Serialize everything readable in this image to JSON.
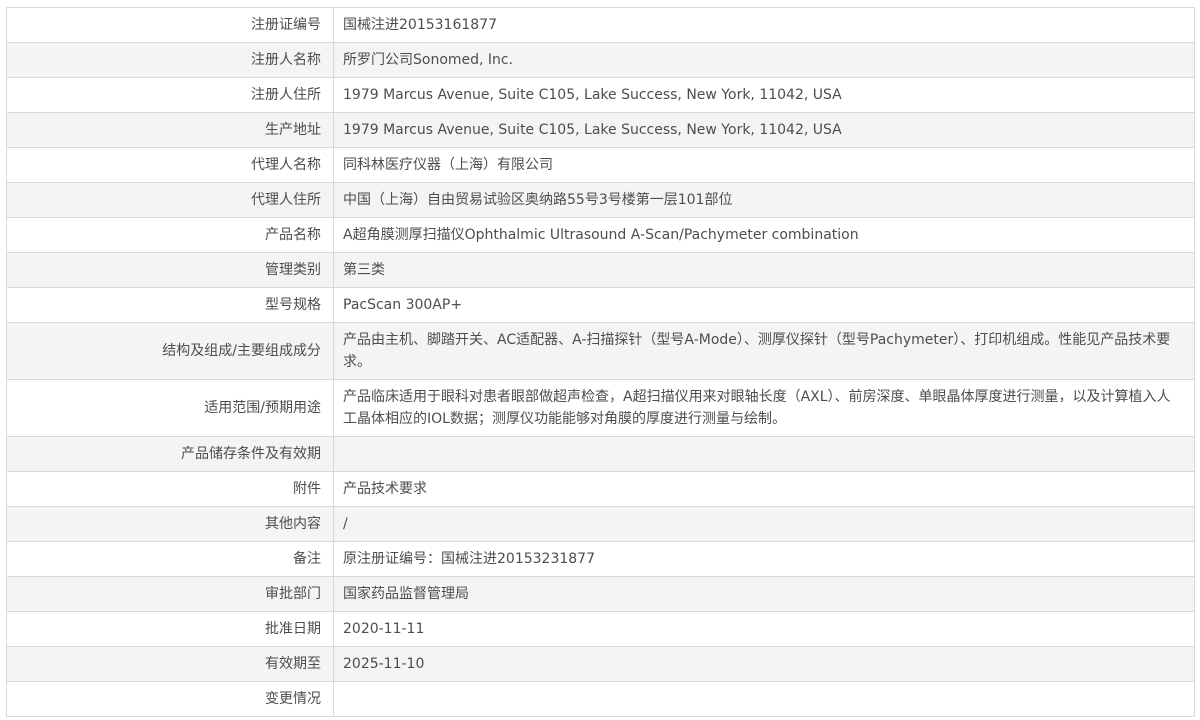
{
  "table": {
    "colors": {
      "row_alt": "#f4f4f4",
      "border": "#d8d8d8",
      "text": "#4d4d4d"
    },
    "rows": [
      {
        "label": "注册证编号",
        "value": "国械注进20153161877"
      },
      {
        "label": "注册人名称",
        "value": "所罗门公司Sonomed, Inc."
      },
      {
        "label": "注册人住所",
        "value": "1979 Marcus Avenue, Suite C105, Lake Success, New York, 11042, USA"
      },
      {
        "label": "生产地址",
        "value": "1979 Marcus Avenue, Suite C105, Lake Success, New York, 11042, USA"
      },
      {
        "label": "代理人名称",
        "value": "同科林医疗仪器（上海）有限公司"
      },
      {
        "label": "代理人住所",
        "value": "中国（上海）自由贸易试验区奥纳路55号3号楼第一层101部位"
      },
      {
        "label": "产品名称",
        "value": "A超角膜测厚扫描仪Ophthalmic Ultrasound A-Scan/Pachymeter combination"
      },
      {
        "label": "管理类别",
        "value": "第三类"
      },
      {
        "label": "型号规格",
        "value": "PacScan 300AP+"
      },
      {
        "label": "结构及组成/主要组成成分",
        "value": "产品由主机、脚踏开关、AC适配器、A-扫描探针（型号A-Mode）、测厚仪探针（型号Pachymeter）、打印机组成。性能见产品技术要求。"
      },
      {
        "label": "适用范围/预期用途",
        "value": "产品临床适用于眼科对患者眼部做超声检查，A超扫描仪用来对眼轴长度（AXL）、前房深度、单眼晶体厚度进行测量，以及计算植入人工晶体相应的IOL数据；测厚仪功能能够对角膜的厚度进行测量与绘制。"
      },
      {
        "label": "产品储存条件及有效期",
        "value": ""
      },
      {
        "label": "附件",
        "value": "产品技术要求"
      },
      {
        "label": "其他内容",
        "value": "/"
      },
      {
        "label": "备注",
        "value": "原注册证编号：国械注进20153231877"
      },
      {
        "label": "审批部门",
        "value": "国家药品监督管理局"
      },
      {
        "label": "批准日期",
        "value": "2020-11-11"
      },
      {
        "label": "有效期至",
        "value": "2025-11-10"
      },
      {
        "label": "变更情况",
        "value": ""
      }
    ]
  }
}
